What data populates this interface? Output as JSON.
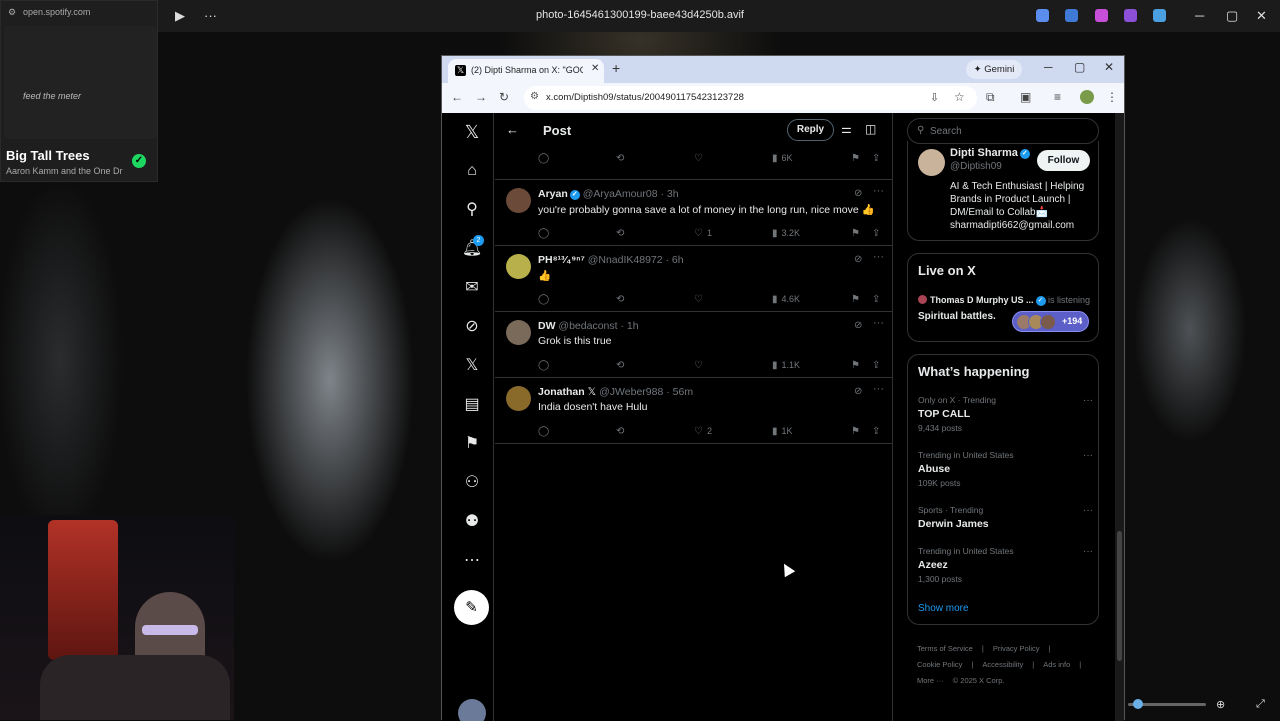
{
  "viewer": {
    "title": "photo-1645461300199-baee43d4250b.avif",
    "min": "─",
    "max": "▢",
    "close": "✕",
    "app_icon_colors": [
      "#5b8def",
      "#3f7ad6",
      "#c94fd8",
      "#8b4fd8",
      "#4aa0e0"
    ]
  },
  "spotify": {
    "url": "open.spotify.com",
    "art_text": "feed the meter",
    "title": "Big Tall Trees",
    "artist": "Aaron Kamm and the One Dr",
    "check": "✓"
  },
  "browser": {
    "tab_title": "(2) Dipti Sharma on X: \"GOOD",
    "tab_close": "✕",
    "new_tab": "+",
    "gemini": "✦ Gemini",
    "url": "x.com/Diptish09/status/2004901175423123728"
  },
  "x": {
    "header": {
      "title": "Post",
      "reply": "Reply"
    },
    "notif_count": "2",
    "tweets": [
      {
        "name": "",
        "handle": "",
        "time": "",
        "text": "",
        "replies": "",
        "likes": "",
        "views": "6K"
      },
      {
        "name": "Aryan",
        "handle": "@AryaAmour08 · 3h",
        "text": "you're probably gonna save a lot of money in the long run, nice move 👍",
        "likes": "1",
        "views": "3.2K"
      },
      {
        "name": "PH⁸¹³⁄₄⁹ⁿ⁷",
        "handle": "@NnadIK48972 · 6h",
        "text": "👍",
        "likes": "",
        "views": "4.6K"
      },
      {
        "name": "DW",
        "handle": "@bedaconst · 1h",
        "text": "Grok is this true",
        "likes": "",
        "views": "1.1K"
      },
      {
        "name": "Jonathan",
        "handle": "@JWeber988 · 56m",
        "text": "India dosen't have Hulu",
        "likes": "2",
        "views": "1K"
      }
    ],
    "sidebar": {
      "search_placeholder": "Search",
      "profile": {
        "name": "Dipti Sharma",
        "handle": "@Diptish09",
        "follow": "Follow",
        "bio": [
          "AI & Tech Enthusiast | Helping",
          "Brands in Product Launch |",
          "DM/Email to Collab📩",
          "sharmadipti662@gmail.com"
        ]
      },
      "live": {
        "title": "Live on X",
        "host": "Thomas D Murphy US ...",
        "status": "is listening",
        "topic": "Spiritual battles.",
        "count": "+194"
      },
      "happening": {
        "title": "What’s happening",
        "trends": [
          {
            "meta": "Only on X · Trending",
            "name": "TOP CALL",
            "count": "9,434 posts"
          },
          {
            "meta": "Trending in United States",
            "name": "Abuse",
            "count": "109K posts"
          },
          {
            "meta": "Sports · Trending",
            "name": "Derwin James",
            "count": ""
          },
          {
            "meta": "Trending in United States",
            "name": "Azeez",
            "count": "1,300 posts"
          }
        ],
        "show_more": "Show more"
      },
      "footer": [
        "Terms of Service",
        "|",
        "Privacy Policy",
        "|",
        "Cookie Policy",
        "|",
        "Accessibility",
        "|",
        "Ads info",
        "|",
        "More ···",
        "© 2025 X Corp."
      ]
    }
  }
}
